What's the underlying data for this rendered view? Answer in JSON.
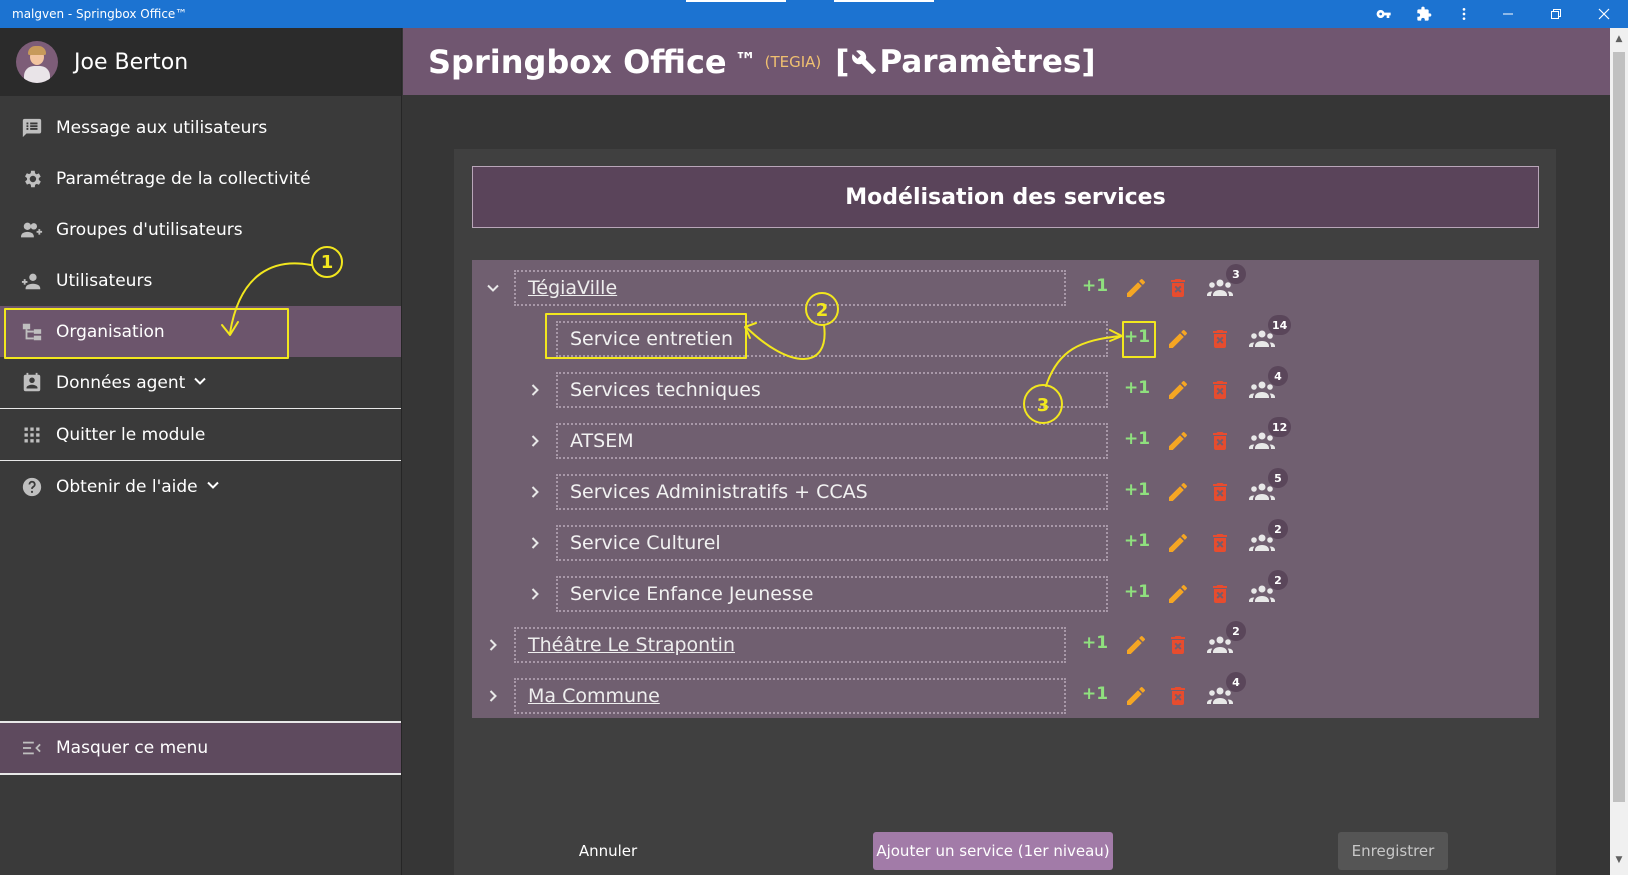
{
  "window": {
    "title": "malgven - Springbox Office™"
  },
  "sidebar": {
    "user_name": "Joe Berton",
    "items": [
      {
        "label": "Message aux utilisateurs",
        "icon": "message-list-icon"
      },
      {
        "label": "Paramétrage de la collectivité",
        "icon": "gear-icon"
      },
      {
        "label": "Groupes d'utilisateurs",
        "icon": "group-add-icon"
      },
      {
        "label": "Utilisateurs",
        "icon": "person-add-icon"
      },
      {
        "label": "Organisation",
        "icon": "org-tree-icon",
        "active": true
      },
      {
        "label": "Données agent",
        "icon": "contact-card-icon",
        "has_submenu": true
      },
      {
        "label": "Quitter le module",
        "icon": "apps-grid-icon"
      },
      {
        "label": "Obtenir de l'aide",
        "icon": "help-icon",
        "has_submenu": true
      }
    ],
    "hide_menu_label": "Masquer ce menu"
  },
  "header": {
    "app_name": "Springbox Office",
    "trademark": "™",
    "tenant": "(TEGIA)",
    "page_prefix": "[",
    "page_title": "Paramètres]"
  },
  "panel": {
    "title": "Modélisation des services"
  },
  "tree": {
    "plus_label": "+1",
    "rows": [
      {
        "name": "TégiaVille",
        "level": 0,
        "expanded": true,
        "count": "3"
      },
      {
        "name": "Service entretien",
        "level": 1,
        "expanded": null,
        "count": "14"
      },
      {
        "name": "Services techniques",
        "level": 1,
        "expanded": false,
        "count": "4"
      },
      {
        "name": "ATSEM",
        "level": 1,
        "expanded": false,
        "count": "12"
      },
      {
        "name": "Services Administratifs + CCAS",
        "level": 1,
        "expanded": false,
        "count": "5"
      },
      {
        "name": "Service Culturel",
        "level": 1,
        "expanded": false,
        "count": "2"
      },
      {
        "name": "Service Enfance Jeunesse",
        "level": 1,
        "expanded": false,
        "count": "2"
      },
      {
        "name": "Théâtre Le Strapontin",
        "level": 0,
        "expanded": false,
        "count": "2"
      },
      {
        "name": "Ma Commune",
        "level": 0,
        "expanded": false,
        "count": "4"
      }
    ]
  },
  "buttons": {
    "cancel": "Annuler",
    "add_service": "Ajouter un service (1er niveau)",
    "save": "Enregistrer"
  },
  "annotations": {
    "marker_1": "1",
    "marker_2": "2",
    "marker_3": "3"
  },
  "colors": {
    "titlebar": "#1c73d1",
    "header": "#705670",
    "sidebar_active": "#6c556c",
    "add_green": "#8fe07e",
    "edit_orange": "#f5a623",
    "delete_red": "#e74c2e",
    "annotation_yellow": "#f2e71e"
  }
}
